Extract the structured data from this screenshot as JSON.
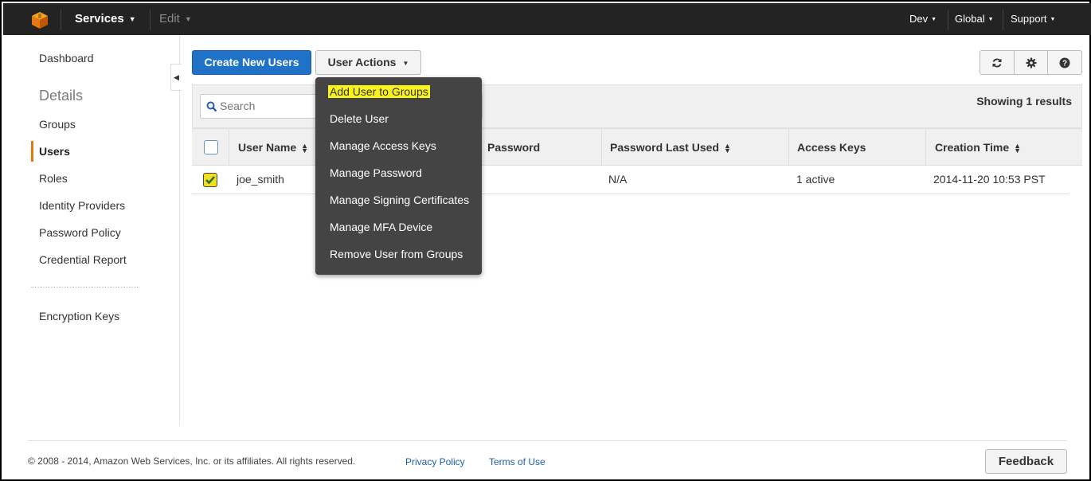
{
  "topbar": {
    "services_label": "Services",
    "edit_label": "Edit",
    "account_label": "Dev",
    "region_label": "Global",
    "support_label": "Support"
  },
  "sidebar": {
    "dashboard": "Dashboard",
    "details_heading": "Details",
    "items": [
      "Groups",
      "Users",
      "Roles",
      "Identity Providers",
      "Password Policy",
      "Credential Report"
    ],
    "active_item": "Users",
    "encryption_keys": "Encryption Keys"
  },
  "toolbar": {
    "create_label": "Create New Users",
    "actions_label": "User Actions"
  },
  "search": {
    "placeholder": "Search"
  },
  "results_text": "Showing 1 results",
  "table": {
    "columns": [
      "User Name",
      "Password",
      "Password Last Used",
      "Access Keys",
      "Creation Time"
    ],
    "rows": [
      {
        "checked": true,
        "user_name": "joe_smith",
        "password": "",
        "password_last_used": "N/A",
        "access_keys": "1 active",
        "creation_time": "2014-11-20 10:53 PST"
      }
    ]
  },
  "menu": {
    "items": [
      "Add User to Groups",
      "Delete User",
      "Manage Access Keys",
      "Manage Password",
      "Manage Signing Certificates",
      "Manage MFA Device",
      "Remove User from Groups"
    ],
    "highlighted": "Add User to Groups"
  },
  "footer": {
    "copyright": "© 2008 - 2014, Amazon Web Services, Inc. or its affiliates. All rights reserved.",
    "privacy": "Privacy Policy",
    "terms": "Terms of Use",
    "feedback": "Feedback"
  },
  "icons": {
    "logo": "aws-cube-icon",
    "refresh": "refresh-icon",
    "settings": "gear-icon",
    "help": "help-icon",
    "search": "search-icon"
  },
  "colors": {
    "topbar_bg": "#232323",
    "primary_button": "#1f72c8",
    "active_accent": "#e47911",
    "menu_bg": "#444444",
    "highlight": "#f8f31a"
  }
}
